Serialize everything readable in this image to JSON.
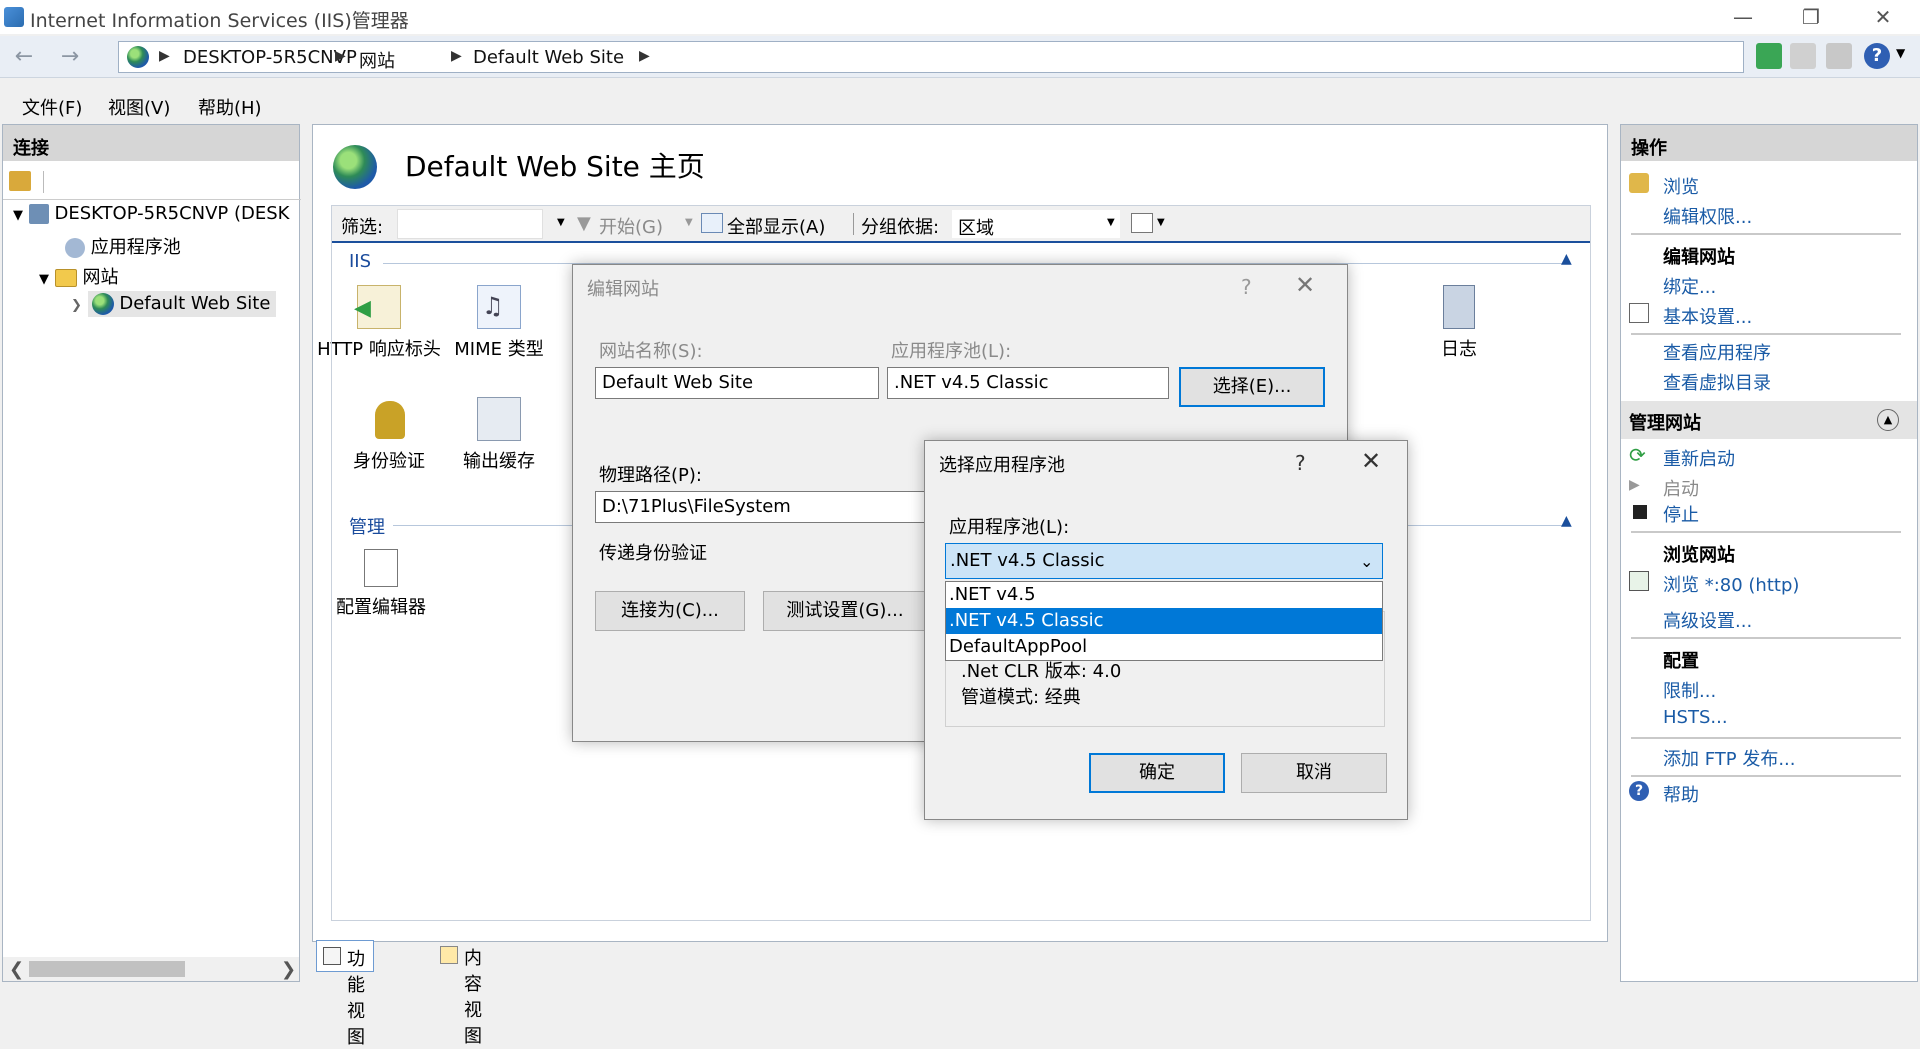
{
  "window": {
    "title": "Internet Information Services (IIS)管理器"
  },
  "address": {
    "crumbs": [
      "DESKTOP-5R5CNVP",
      "网站",
      "Default Web Site"
    ]
  },
  "menu": {
    "items": [
      "文件(F)",
      "视图(V)",
      "帮助(H)"
    ]
  },
  "connections": {
    "header": "连接",
    "tree": {
      "server": "DESKTOP-5R5CNVP (DESK",
      "app_pools": "应用程序池",
      "sites": "网站",
      "default_site": "Default Web Site"
    }
  },
  "main": {
    "title": "Default Web Site 主页",
    "filter_label": "筛选:",
    "filter_value": "",
    "start_label": "开始(G)",
    "show_all_label": "全部显示(A)",
    "group_by_label": "分组依据:",
    "group_by_value": "区域",
    "groups": {
      "iis": "IIS",
      "manage": "管理"
    },
    "features": {
      "http_headers": "HTTP 响应标头",
      "mime": "MIME 类型",
      "auth": "身份验证",
      "output_cache": "输出缓存",
      "logging": "日志",
      "config_editor": "配置编辑器"
    },
    "view_tabs": [
      "功能视图",
      "内容视图"
    ]
  },
  "actions": {
    "header": "操作",
    "browse": "浏览",
    "edit_permissions": "编辑权限...",
    "edit_site_header": "编辑网站",
    "bindings": "绑定...",
    "basic_settings": "基本设置...",
    "view_applications": "查看应用程序",
    "view_virtual_dirs": "查看虚拟目录",
    "manage_site_header": "管理网站",
    "restart": "重新启动",
    "start": "启动",
    "stop": "停止",
    "browse_site_header": "浏览网站",
    "browse_80": "浏览 *:80 (http)",
    "advanced_settings": "高级设置...",
    "config_header": "配置",
    "limits": "限制...",
    "hsts": "HSTS...",
    "add_ftp": "添加 FTP 发布...",
    "help": "帮助"
  },
  "edit_site_dialog": {
    "title": "编辑网站",
    "site_name_label": "网站名称(S):",
    "site_name_value": "Default Web Site",
    "app_pool_label": "应用程序池(L):",
    "app_pool_value": ".NET v4.5 Classic",
    "select_button": "选择(E)...",
    "physical_path_label": "物理路径(P):",
    "physical_path_value": "D:\\71Plus\\FileSystem",
    "passthrough_label": "传递身份验证",
    "connect_as_button": "连接为(C)...",
    "test_settings_button": "测试设置(G)..."
  },
  "select_pool_dialog": {
    "title": "选择应用程序池",
    "pool_label": "应用程序池(L):",
    "selected_value": ".NET v4.5 Classic",
    "options": [
      ".NET v4.5",
      ".NET v4.5 Classic",
      "DefaultAppPool"
    ],
    "clr_version": ".Net CLR 版本: 4.0",
    "pipeline_mode": "管道模式: 经典",
    "ok_button": "确定",
    "cancel_button": "取消"
  }
}
